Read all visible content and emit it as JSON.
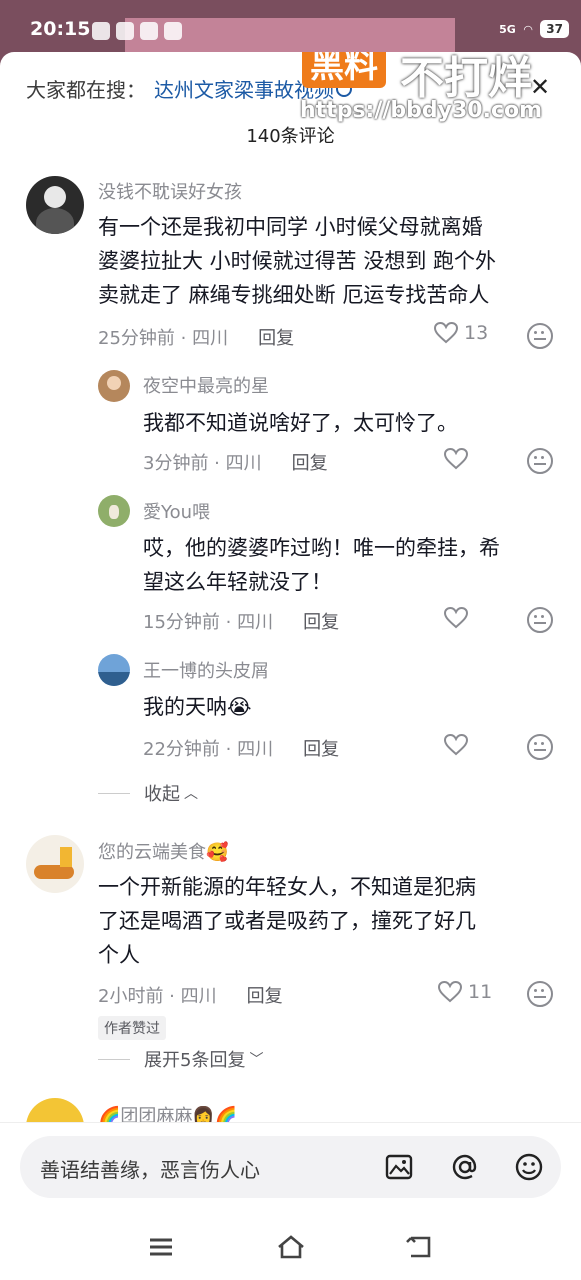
{
  "status": {
    "time": "20:15",
    "network": "5G",
    "battery": "37"
  },
  "watermark": {
    "brand": "黑料",
    "slogan": "不打烊",
    "url": "https://bbdy30.com"
  },
  "search": {
    "label": "大家都在搜：",
    "term": "达州文家梁事故视频"
  },
  "header": {
    "comment_count": "140条评论"
  },
  "comments": [
    {
      "user": "没钱不耽误好女孩",
      "text_lines": [
        "有一个还是我初中同学 小时候父母就离婚",
        "婆婆拉扯大 小时候就过得苦 没想到 跑个外",
        "卖就走了 麻绳专挑细处断 厄运专找苦命人"
      ],
      "time_loc": "25分钟前 · 四川",
      "reply": "回复",
      "likes": "13"
    },
    {
      "user": "夜空中最亮的星",
      "text_lines": [
        "我都不知道说啥好了，太可怜了。"
      ],
      "time_loc": "3分钟前 · 四川",
      "reply": "回复",
      "likes": ""
    },
    {
      "user": "愛You喂",
      "text_lines": [
        "哎，他的婆婆咋过哟！唯一的牵挂，希",
        "望这么年轻就没了！"
      ],
      "time_loc": "15分钟前 · 四川",
      "reply": "回复",
      "likes": ""
    },
    {
      "user": "王一博的头皮屑",
      "text_lines": [
        "我的天呐😭"
      ],
      "time_loc": "22分钟前 · 四川",
      "reply": "回复",
      "likes": ""
    },
    {
      "user": "您的云端美食🥰",
      "text_lines": [
        "一个开新能源的年轻女人，不知道是犯病",
        "了还是喝酒了或者是吸药了，撞死了好几",
        "个人"
      ],
      "time_loc": "2小时前 · 四川",
      "reply": "回复",
      "likes": "11",
      "tag": "作者赞过"
    },
    {
      "user": "🌈团团麻麻👩🌈",
      "text_lines": [],
      "time_loc": "",
      "reply": "",
      "likes": ""
    }
  ],
  "collapse_label": "收起",
  "expand_label": "展开5条回复",
  "input": {
    "placeholder": "善语结善缘，恶言伤人心"
  },
  "icons": [
    "search-icon",
    "close-icon",
    "heart-icon",
    "dislike-icon",
    "image-icon",
    "at-icon",
    "emoji-icon",
    "menu-icon",
    "home-icon",
    "back-icon"
  ]
}
